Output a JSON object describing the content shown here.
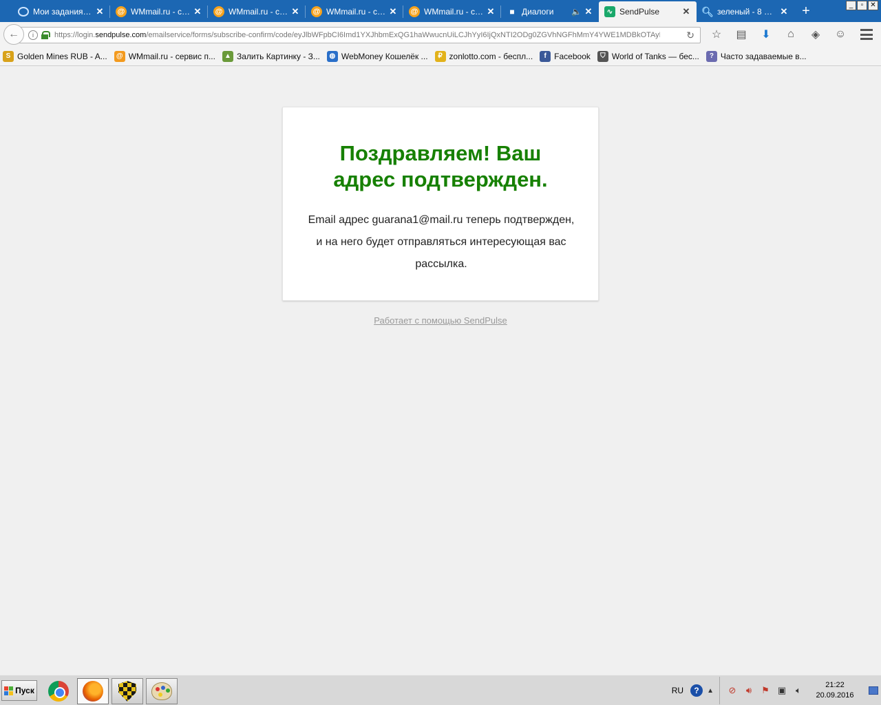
{
  "browser": {
    "tabs": [
      {
        "title": "Мои задания п...",
        "icon": "spiral-icon",
        "active": false
      },
      {
        "title": "WMmail.ru - се...",
        "icon": "wmmail-icon",
        "active": false
      },
      {
        "title": "WMmail.ru - се...",
        "icon": "wmmail-icon",
        "active": false
      },
      {
        "title": "WMmail.ru - се...",
        "icon": "wmmail-icon",
        "active": false
      },
      {
        "title": "WMmail.ru - се...",
        "icon": "wmmail-icon",
        "active": false
      },
      {
        "title": "Диалоги",
        "icon": "chat-icon",
        "active": false,
        "audio": true
      },
      {
        "title": "SendPulse",
        "icon": "sendpulse-icon",
        "active": true
      },
      {
        "title": "зеленый - 8 мл...",
        "icon": "search-icon",
        "active": false
      }
    ],
    "url_prefix": "https://login.",
    "url_domain": "sendpulse.com",
    "url_path": "/emailservice/forms/subscribe-confirm/code/eyJlbWFpbCI6Imd1YXJhbmExQG1haWwucnUiLCJhYyI6IjQxNTI2ODg0ZGVhNGFhMmY4YWE1MDBkOTAyNjRlZD",
    "bookmarks": [
      {
        "label": "Golden Mines RUB - A...",
        "icon": "dollar-icon",
        "color": "#d8a21a"
      },
      {
        "label": "WMmail.ru - сервис п...",
        "icon": "wmmail-icon",
        "color": "#f39a1e"
      },
      {
        "label": "Залить Картинку - З...",
        "icon": "picture-icon",
        "color": "#6a9a3a"
      },
      {
        "label": "WebMoney Кошелёк ...",
        "icon": "globe-icon",
        "color": "#2a6fc9"
      },
      {
        "label": "zonlotto.com - беспл...",
        "icon": "coin-icon",
        "color": "#e2b21a"
      },
      {
        "label": "Facebook",
        "icon": "facebook-icon",
        "color": "#3b5998"
      },
      {
        "label": "World of Tanks — бес...",
        "icon": "tank-icon",
        "color": "#555555"
      },
      {
        "label": "Часто задаваемые в...",
        "icon": "faq-icon",
        "color": "#6b6bb0"
      }
    ]
  },
  "page": {
    "heading": "Поздравляем! Ваш адрес подтвержден.",
    "message": "Email адрес guarana1@mail.ru теперь подтвержден, и на него будет отправляться интересующая вас рассылка.",
    "powered_by": "Работает с помощью SendPulse",
    "heading_color": "#168000"
  },
  "taskbar": {
    "start_label": "Пуск",
    "apps": [
      "chrome-icon",
      "firefox-icon",
      "security-shield-icon",
      "paint-icon"
    ],
    "language": "RU",
    "time": "21:22",
    "date": "20.09.2016"
  }
}
